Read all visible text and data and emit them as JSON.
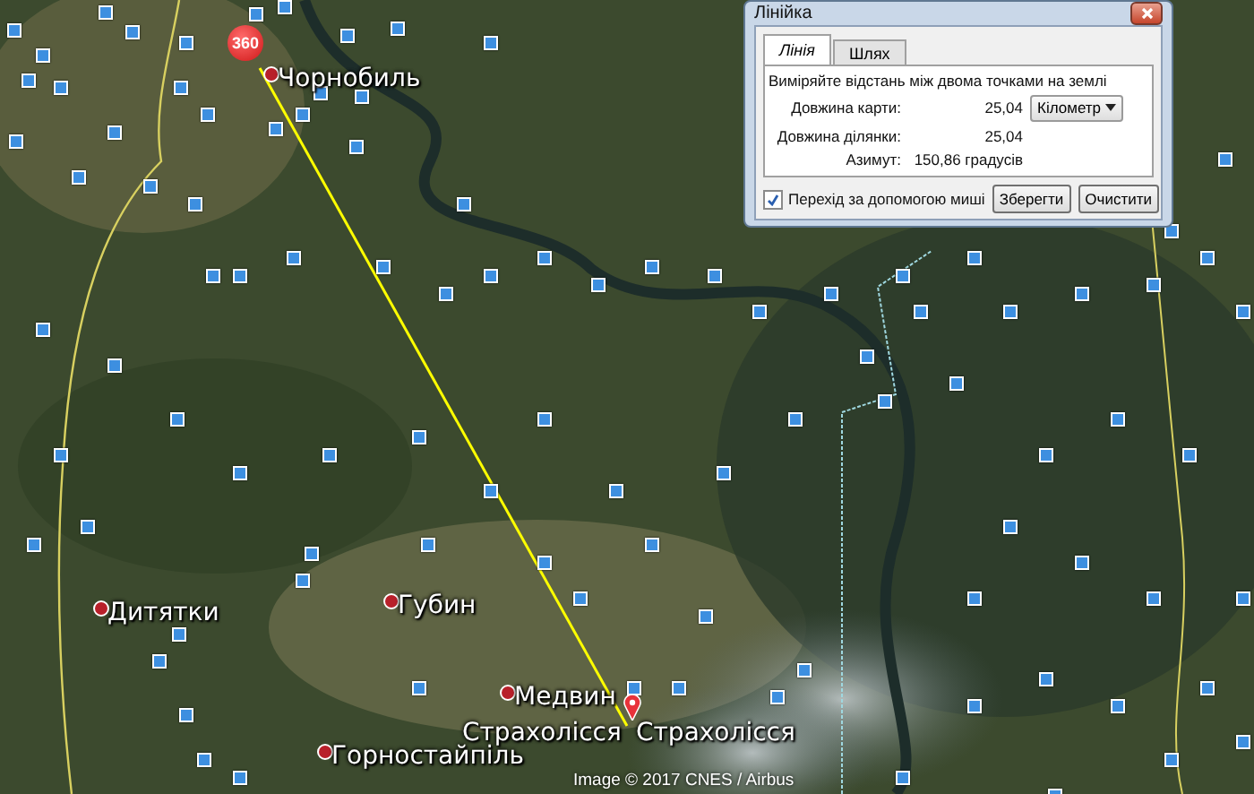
{
  "map": {
    "badge": "360",
    "attribution": "Image © 2017 CNES / Airbus",
    "places": [
      {
        "name": "Чорнобиль",
        "kind": "dot"
      },
      {
        "name": "Дитятки",
        "kind": "dot"
      },
      {
        "name": "Губин",
        "kind": "dot"
      },
      {
        "name": "Медвин",
        "kind": "dot"
      },
      {
        "name": "Страхолісся",
        "kind": "label"
      },
      {
        "name": "Страхолісся",
        "kind": "pin"
      },
      {
        "name": "Горностайпіль",
        "kind": "dot"
      }
    ]
  },
  "ruler_dialog": {
    "title": "Лінійка",
    "tabs": [
      {
        "label": "Лінія",
        "selected": true
      },
      {
        "label": "Шлях",
        "selected": false
      }
    ],
    "instruction": "Виміряйте відстань між двома точками на землі",
    "rows": [
      {
        "label": "Довжина карти:",
        "value": "25,04",
        "unit": "Кілометр"
      },
      {
        "label": "Довжина ділянки:",
        "value": "25,04"
      },
      {
        "label": "Азимут:",
        "value": "150,86 градусів"
      }
    ],
    "mouse_navigation": {
      "label": "Перехід за допомогою миші",
      "checked": true
    },
    "buttons": [
      "Зберегти",
      "Очистити"
    ]
  }
}
